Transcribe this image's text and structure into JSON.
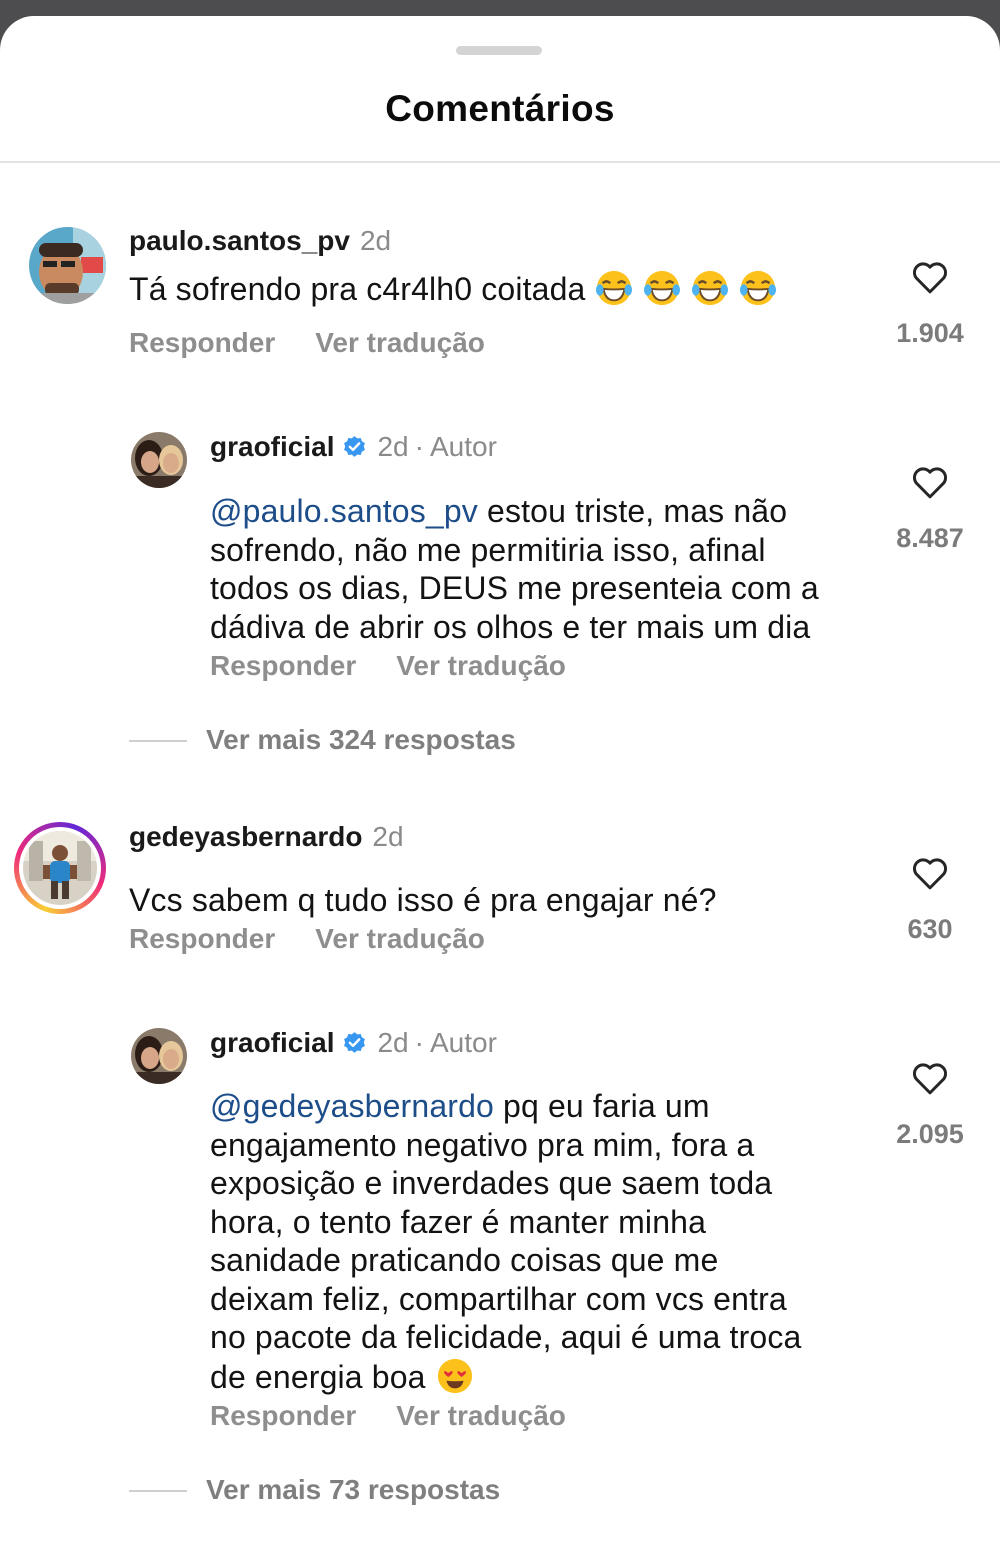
{
  "header": {
    "title": "Comentários"
  },
  "comments": [
    {
      "username": "paulo.santos_pv",
      "time": "2d",
      "text": "Tá sofrendo pra c4r4lh0 coitada",
      "emojis": [
        "joy",
        "joy",
        "joy",
        "joy"
      ],
      "reply_label": "Responder",
      "translate_label": "Ver tradução",
      "likes": "1.904",
      "reply": {
        "username": "graoficial",
        "time": "2d",
        "separator": "·",
        "author_label": "Autor",
        "mention": "@paulo.santos_pv",
        "text_lines": [
          " estou triste, mas não",
          "sofrendo, não me permitiria isso, afinal",
          "todos os dias, DEUS me presenteia com a",
          "dádiva de abrir os olhos e ter mais um dia"
        ],
        "reply_label": "Responder",
        "translate_label": "Ver tradução",
        "likes": "8.487"
      },
      "more_replies": "Ver mais 324 respostas"
    },
    {
      "username": "gedeyasbernardo",
      "time": "2d",
      "text": "Vcs sabem q tudo isso é pra engajar né?",
      "reply_label": "Responder",
      "translate_label": "Ver tradução",
      "likes": "630",
      "reply": {
        "username": "graoficial",
        "time": "2d",
        "separator": "·",
        "author_label": "Autor",
        "mention": "@gedeyasbernardo",
        "text_lines": [
          " pq eu faria um",
          "engajamento negativo pra mim, fora a",
          "exposição e inverdades que saem toda",
          "hora, o tento fazer é manter minha",
          "sanidade praticando coisas que me",
          "deixam feliz, compartilhar com vcs entra",
          "no pacote da felicidade, aqui é uma troca",
          "de energia boa"
        ],
        "emoji": "heart-eyes",
        "reply_label": "Responder",
        "translate_label": "Ver tradução",
        "likes": "2.095"
      },
      "more_replies": "Ver mais 73 respostas"
    }
  ],
  "colors": {
    "mention": "#1d4e89",
    "verified": "#3897f0",
    "muted": "#8e8e8e"
  },
  "icons": [
    "heart-outline-icon",
    "verified-badge-icon",
    "laughing-tears-emoji",
    "heart-eyes-emoji"
  ]
}
